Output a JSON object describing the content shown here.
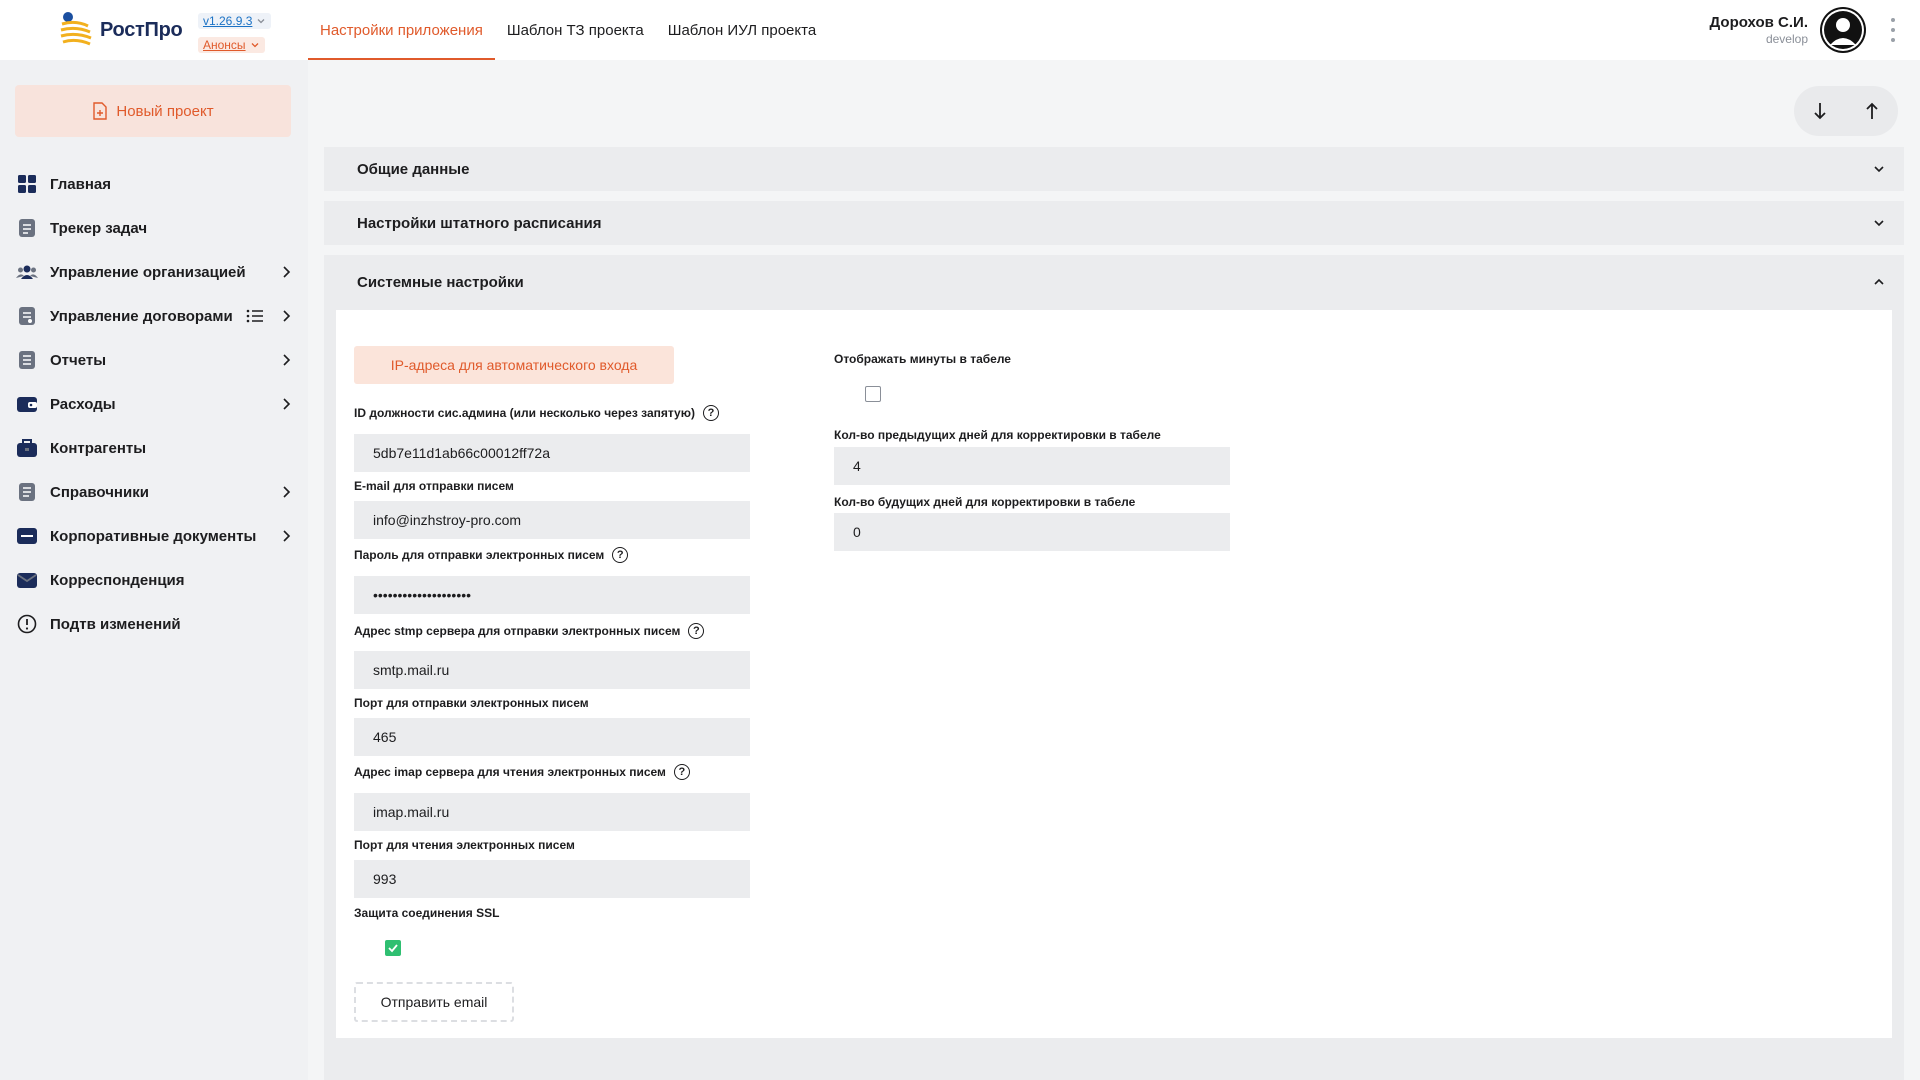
{
  "header": {
    "logo_text": "РостПро",
    "version": "v1.26.9.3",
    "announcements": "Анонсы",
    "tabs": [
      {
        "label": "Настройки приложения",
        "active": true
      },
      {
        "label": "Шаблон ТЗ проекта",
        "active": false
      },
      {
        "label": "Шаблон ИУЛ проекта",
        "active": false
      }
    ],
    "user_name": "Дорохов С.И.",
    "user_role": "develop"
  },
  "sidebar": {
    "new_project": "Новый проект",
    "items": [
      {
        "label": "Главная",
        "icon": "grid-icon"
      },
      {
        "label": "Трекер задач",
        "icon": "document-icon"
      },
      {
        "label": "Управление организацией",
        "icon": "users-icon"
      },
      {
        "label": "Управление договорами",
        "icon": "contract-icon"
      },
      {
        "label": "Отчеты",
        "icon": "report-icon"
      },
      {
        "label": "Расходы",
        "icon": "wallet-icon"
      },
      {
        "label": "Контрагенты",
        "icon": "briefcase-icon"
      },
      {
        "label": "Справочники",
        "icon": "book-icon"
      },
      {
        "label": "Корпоративные документы",
        "icon": "folder-icon"
      },
      {
        "label": "Корреспонденция",
        "icon": "mail-icon"
      },
      {
        "label": "Подтв изменений",
        "icon": "alert-icon"
      }
    ]
  },
  "accordions": {
    "general": "Общие данные",
    "staff": "Настройки штатного расписания",
    "system": "Системные настройки"
  },
  "system": {
    "ip_button": "IP-адреса для автоматического входа",
    "admin_id_label": "ID должности сис.админа (или несколько через запятую)",
    "admin_id_value": "5db7e11d1ab66c00012ff72a",
    "email_label": "E-mail для отправки писем",
    "email_value": "info@inzhstroy-pro.com",
    "password_label": "Пароль для отправки электронных писем",
    "password_value": "••••••••••••••••••••",
    "smtp_label": "Адрес stmp сервера для отправки электронных писем",
    "smtp_value": "smtp.mail.ru",
    "smtp_port_label": "Порт для отправки электронных писем",
    "smtp_port_value": "465",
    "imap_label": "Адрес imap сервера для чтения электронных писем",
    "imap_value": "imap.mail.ru",
    "imap_port_label": "Порт для чтения электронных писем",
    "imap_port_value": "993",
    "ssl_label": "Защита соединения SSL",
    "send_email": "Отправить email",
    "minutes_label": "Отображать минуты в табеле",
    "prev_days_label": "Кол-во предыдущих дней для корректировки в табеле",
    "prev_days_value": "4",
    "next_days_label": "Кол-во будущих дней для корректировки в табеле",
    "next_days_value": "0"
  },
  "colors": {
    "accent": "#e05a2b",
    "check": "#2fbf71"
  }
}
